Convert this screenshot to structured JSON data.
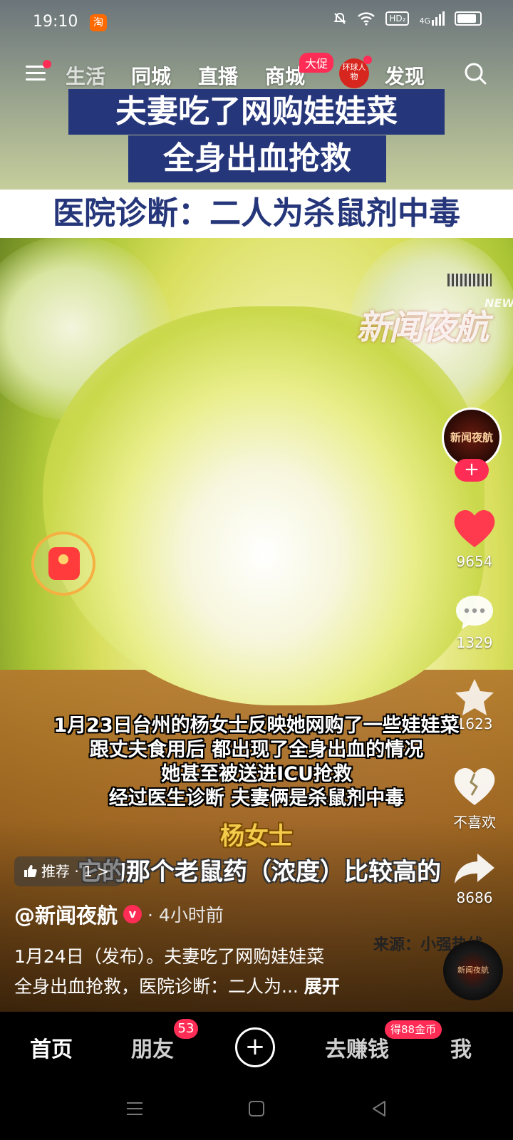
{
  "status_bar": {
    "time": "19:10",
    "taobao_icon": "淘",
    "hd_label": "HD₂",
    "signal_label": "4G"
  },
  "top_nav": {
    "tabs": [
      "生活",
      "同城",
      "直播",
      "商城",
      "发现"
    ],
    "shop_badge": "大促",
    "logo_text": "环球人物"
  },
  "video": {
    "headline_line1": "夫妻吃了网购娃娃菜",
    "headline_line2": "全身出血抢救",
    "headline_line3": "医院诊断：二人为杀鼠剂中毒",
    "watermark": "新闻夜航",
    "watermark_news": "NEWS",
    "subtitles": [
      "1月23日台州的杨女士反映她网购了一些娃娃菜",
      "跟丈夫食用后 都出现了全身出血的情况",
      "她甚至被送进ICU抢救",
      "经过医生诊断 夫妻俩是杀鼠剂中毒"
    ],
    "speaker": "杨女士",
    "quote": "它的那个老鼠药（浓度）比较高的",
    "source": "来源：小强热线",
    "recommend_label": "推荐 · 1 >"
  },
  "right_rail": {
    "avatar_text": "新闻夜航",
    "likes": "9654",
    "comments": "1329",
    "favorites": "1623",
    "dislike_label": "不喜欢",
    "shares": "8686"
  },
  "post": {
    "author": "@新闻夜航",
    "time_ago": "· 4小时前",
    "description_line1": "1月24日（发布）。夫妻吃了网购娃娃菜",
    "description_line2": "全身出血抢救，医院诊断：二人为...",
    "expand_label": "展开",
    "disc_text": "新闻夜航"
  },
  "bottom_nav": {
    "home": "首页",
    "friends": "朋友",
    "friends_badge": "53",
    "plus": "+",
    "earn": "去赚钱",
    "earn_badge": "得88金币",
    "me": "我"
  },
  "colors": {
    "accent": "#ff2d55",
    "banner": "#26367a",
    "speaker": "#f4cc4c"
  }
}
